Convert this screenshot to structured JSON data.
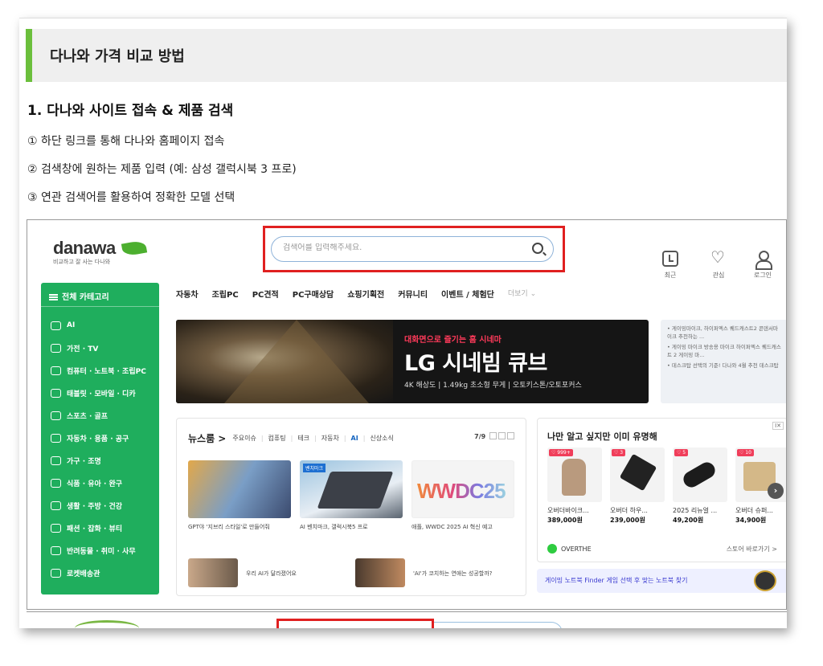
{
  "section": {
    "title": "다나와 가격 비교 방법"
  },
  "step": {
    "title": "1. 다나와 사이트 접속 & 제품 검색",
    "lines": [
      "① 하단 링크를 통해 다나와 홈페이지 접속",
      "② 검색창에 원하는 제품 입력 (예: 삼성 갤럭시북 3 프로)",
      "③ 연관 검색어를 활용하여 정확한 모델 선택"
    ]
  },
  "site": {
    "logo_name": "danawa",
    "logo_tagline": "비교하고 잘 사는 다나와",
    "search_placeholder": "검색어를 입력해주세요.",
    "util": {
      "recent": "최근",
      "wish": "관심",
      "login": "로그인"
    },
    "all_category": "전체 카테고리",
    "categories": [
      "AI",
      "가전 · TV",
      "컴퓨터 · 노트북 · 조립PC",
      "태블릿 · 모바일 · 디카",
      "스포츠 · 골프",
      "자동차 · 용품 · 공구",
      "가구 · 조명",
      "식품 · 유아 · 완구",
      "생활 · 주방 · 건강",
      "패션 · 잡화 · 뷰티",
      "반려동물 · 취미 · 사무",
      "로켓배송관"
    ],
    "nav": [
      "자동차",
      "조립PC",
      "PC견적",
      "PC구매상담",
      "쇼핑기획전",
      "커뮤니티",
      "이벤트 / 체험단",
      "더보기 ⌄"
    ],
    "banner": {
      "sub": "대화면으로 즐기는 홈 시네마",
      "main": "LG 시네빔 큐브",
      "spec": "4K 해상도 | 1.49kg 초소형 무게 | 오토키스톤/오토포커스"
    },
    "side_notes": [
      "• 게이밍마이크, 하이퍼엑스 퀘드캐스트2 콘덴서마이크 추천하는 ...",
      "• 게이밍 마이크 방송용 마이크 하이퍼엑스 퀘드캐스트 2 게이밍 마...",
      "• 데스크탑 선택의 기준! 다나와 4월 추천 데스크탑"
    ],
    "news": {
      "title": "뉴스룸 >",
      "tabs": [
        "주요이슈",
        "컴퓨팅",
        "테크",
        "자동차",
        "AI",
        "신상소식"
      ],
      "pager": "7/9",
      "badge": "벤치마크",
      "wwdc": "WWDC25",
      "captions": [
        "GPT야 '지브리 스타일'로 만들어줘",
        "AI 벤치마크, 갤럭시북5 프로",
        "애플, WWDC 2025 AI 혁신 예고"
      ],
      "mini_captions": [
        "우리 AI가 달라졌어요",
        "'AI'가 코치하는 연애는 성공할까?"
      ]
    },
    "shop": {
      "title": "나만 알고 싶지만 이미 유명해",
      "close": "Ⅰ✕",
      "products": [
        {
          "badge": "♡ 999+",
          "name": "오버더바이크...",
          "price": "389,000원"
        },
        {
          "badge": "♡ 3",
          "name": "오버더 하우...",
          "price": "239,000원"
        },
        {
          "badge": "♡ 5",
          "name": "2025 리뉴얼 ...",
          "price": "49,200원"
        },
        {
          "badge": "♡ 10",
          "name": "오버더 슈퍼...",
          "price": "34,900원"
        }
      ],
      "brand": "OVERTHE",
      "store_link": "스토어 바로가기 >",
      "next": "›"
    },
    "finder": "게이밍 노트북 Finder 게임 선택 후 맞는 노트북 찾기"
  }
}
